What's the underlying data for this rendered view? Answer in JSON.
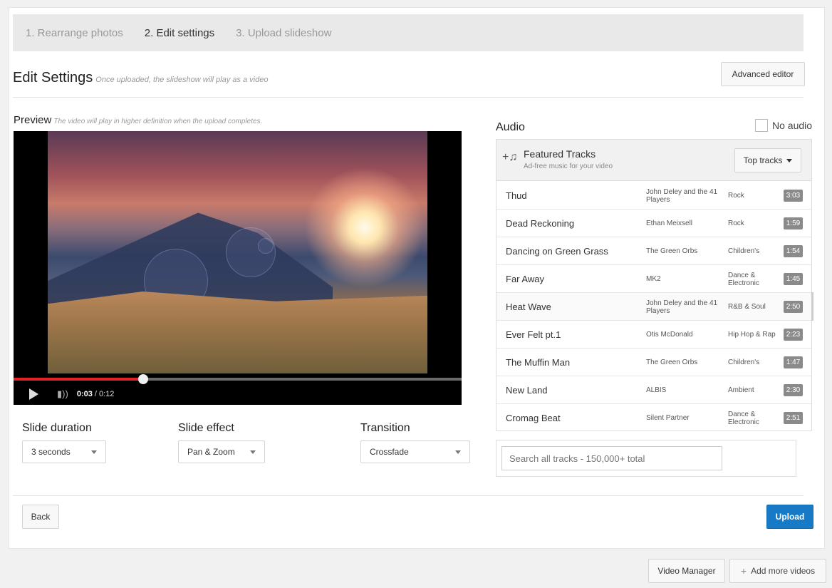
{
  "steps": [
    "1. Rearrange photos",
    "2. Edit settings",
    "3. Upload slideshow"
  ],
  "header": {
    "title": "Edit Settings",
    "subtitle": "Once uploaded, the slideshow will play as a video",
    "advanced_editor": "Advanced editor"
  },
  "preview": {
    "label": "Preview",
    "note": "The video will play in higher definition when the upload completes.",
    "current_time": "0:03",
    "duration": "/ 0:12",
    "progress": 0.29
  },
  "settings": {
    "slide_duration": {
      "label": "Slide duration",
      "value": "3 seconds"
    },
    "slide_effect": {
      "label": "Slide effect",
      "value": "Pan & Zoom"
    },
    "transition": {
      "label": "Transition",
      "value": "Crossfade"
    }
  },
  "audio": {
    "label": "Audio",
    "no_audio": "No audio",
    "featured_title": "Featured Tracks",
    "featured_sub": "Ad-free music for your video",
    "top_tracks": "Top tracks",
    "search_placeholder": "Search all tracks - 150,000+ total",
    "tracks": [
      {
        "title": "Thud",
        "artist": "John Deley and the 41 Players",
        "genre": "Rock",
        "duration": "3:03"
      },
      {
        "title": "Dead Reckoning",
        "artist": "Ethan Meixsell",
        "genre": "Rock",
        "duration": "1:59"
      },
      {
        "title": "Dancing on Green Grass",
        "artist": "The Green Orbs",
        "genre": "Children's",
        "duration": "1:54"
      },
      {
        "title": "Far Away",
        "artist": "MK2",
        "genre": "Dance & Electronic",
        "duration": "1:45"
      },
      {
        "title": "Heat Wave",
        "artist": "John Deley and the 41 Players",
        "genre": "R&B & Soul",
        "duration": "2:50"
      },
      {
        "title": "Ever Felt pt.1",
        "artist": "Otis McDonald",
        "genre": "Hip Hop & Rap",
        "duration": "2:23"
      },
      {
        "title": "The Muffin Man",
        "artist": "The Green Orbs",
        "genre": "Children's",
        "duration": "1:47"
      },
      {
        "title": "New Land",
        "artist": "ALBIS",
        "genre": "Ambient",
        "duration": "2:30"
      },
      {
        "title": "Cromag Beat",
        "artist": "Silent Partner",
        "genre": "Dance & Electronic",
        "duration": "2:51"
      }
    ]
  },
  "footer": {
    "back": "Back",
    "upload": "Upload",
    "video_manager": "Video Manager",
    "add_more": "Add more videos"
  },
  "icons": {
    "music": "music-note-icon",
    "play": "play-icon",
    "volume": "volume-icon",
    "plus": "plus-icon"
  },
  "colors": {
    "upload_blue": "#167ac6",
    "progress_red": "#e02424"
  }
}
